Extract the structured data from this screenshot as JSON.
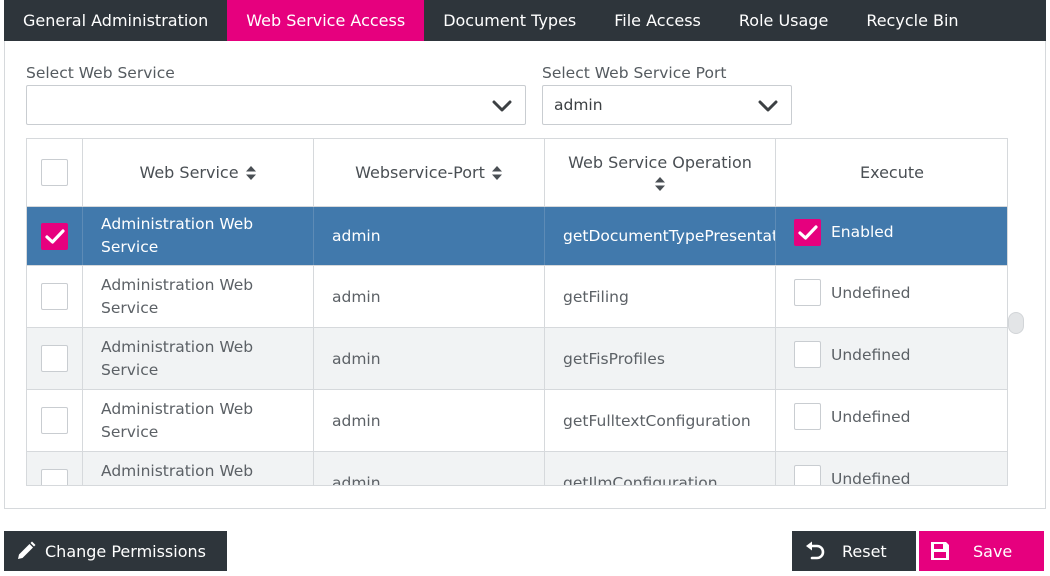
{
  "tabs": [
    {
      "label": "General Administration",
      "active": false
    },
    {
      "label": "Web Service Access",
      "active": true
    },
    {
      "label": "Document Types",
      "active": false
    },
    {
      "label": "File Access",
      "active": false
    },
    {
      "label": "Role Usage",
      "active": false
    },
    {
      "label": "Recycle Bin",
      "active": false
    }
  ],
  "filters": {
    "service": {
      "label": "Select Web Service",
      "value": ""
    },
    "port": {
      "label": "Select Web Service Port",
      "value": "admin"
    }
  },
  "table": {
    "headers": {
      "service": "Web Service",
      "port": "Webservice-Port",
      "operation": "Web Service Operation",
      "execute": "Execute"
    },
    "rows": [
      {
        "service": "Administration Web Service",
        "port": "admin",
        "operation": "getDocumentTypePresentation",
        "execute": "Enabled",
        "selected": true
      },
      {
        "service": "Administration Web Service",
        "port": "admin",
        "operation": "getFiling",
        "execute": "Undefined",
        "selected": false
      },
      {
        "service": "Administration Web Service",
        "port": "admin",
        "operation": "getFisProfiles",
        "execute": "Undefined",
        "selected": false
      },
      {
        "service": "Administration Web Service",
        "port": "admin",
        "operation": "getFulltextConfiguration",
        "execute": "Undefined",
        "selected": false
      },
      {
        "service": "Administration Web Service",
        "port": "admin",
        "operation": "getIlmConfiguration",
        "execute": "Undefined",
        "selected": false
      }
    ]
  },
  "buttons": {
    "change_permissions": "Change Permissions",
    "reset": "Reset",
    "save": "Save"
  },
  "colors": {
    "accent": "#e6007e",
    "dark": "#2e353b",
    "selected_row": "#4179ac"
  },
  "icons": {
    "sort": "sort-icon",
    "dropdown": "chevron-down-icon",
    "check": "checkmark-icon",
    "pencil": "pencil-icon",
    "reset": "undo-icon",
    "save": "floppy-disk-icon"
  }
}
